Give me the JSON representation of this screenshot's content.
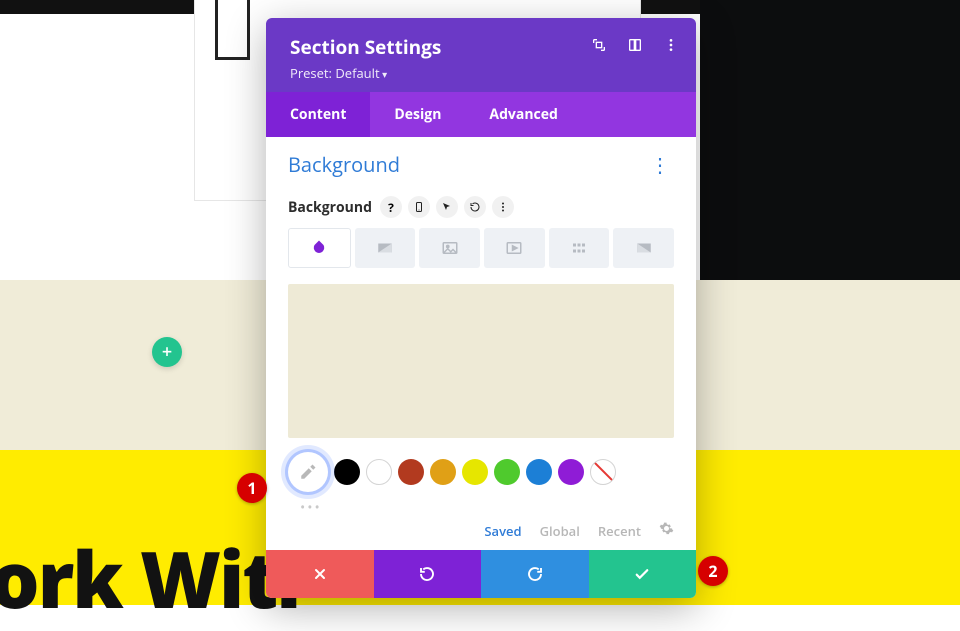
{
  "page": {
    "big_text": "ork Witl",
    "add_icon": "+"
  },
  "modal": {
    "title": "Section Settings",
    "preset": "Preset: Default",
    "tabs": {
      "content": "Content",
      "design": "Design",
      "advanced": "Advanced"
    },
    "section_title": "Background",
    "bg_label": "Background",
    "color_preview": "#eeead6",
    "swatches": [
      "#000000",
      "#ffffff",
      "#b23a1f",
      "#e0a016",
      "#e6e600",
      "#4fca2d",
      "#1c7fd6",
      "#8f1cd6"
    ],
    "palette_tabs": {
      "saved": "Saved",
      "global": "Global",
      "recent": "Recent"
    }
  },
  "callouts": {
    "one": "1",
    "two": "2"
  }
}
